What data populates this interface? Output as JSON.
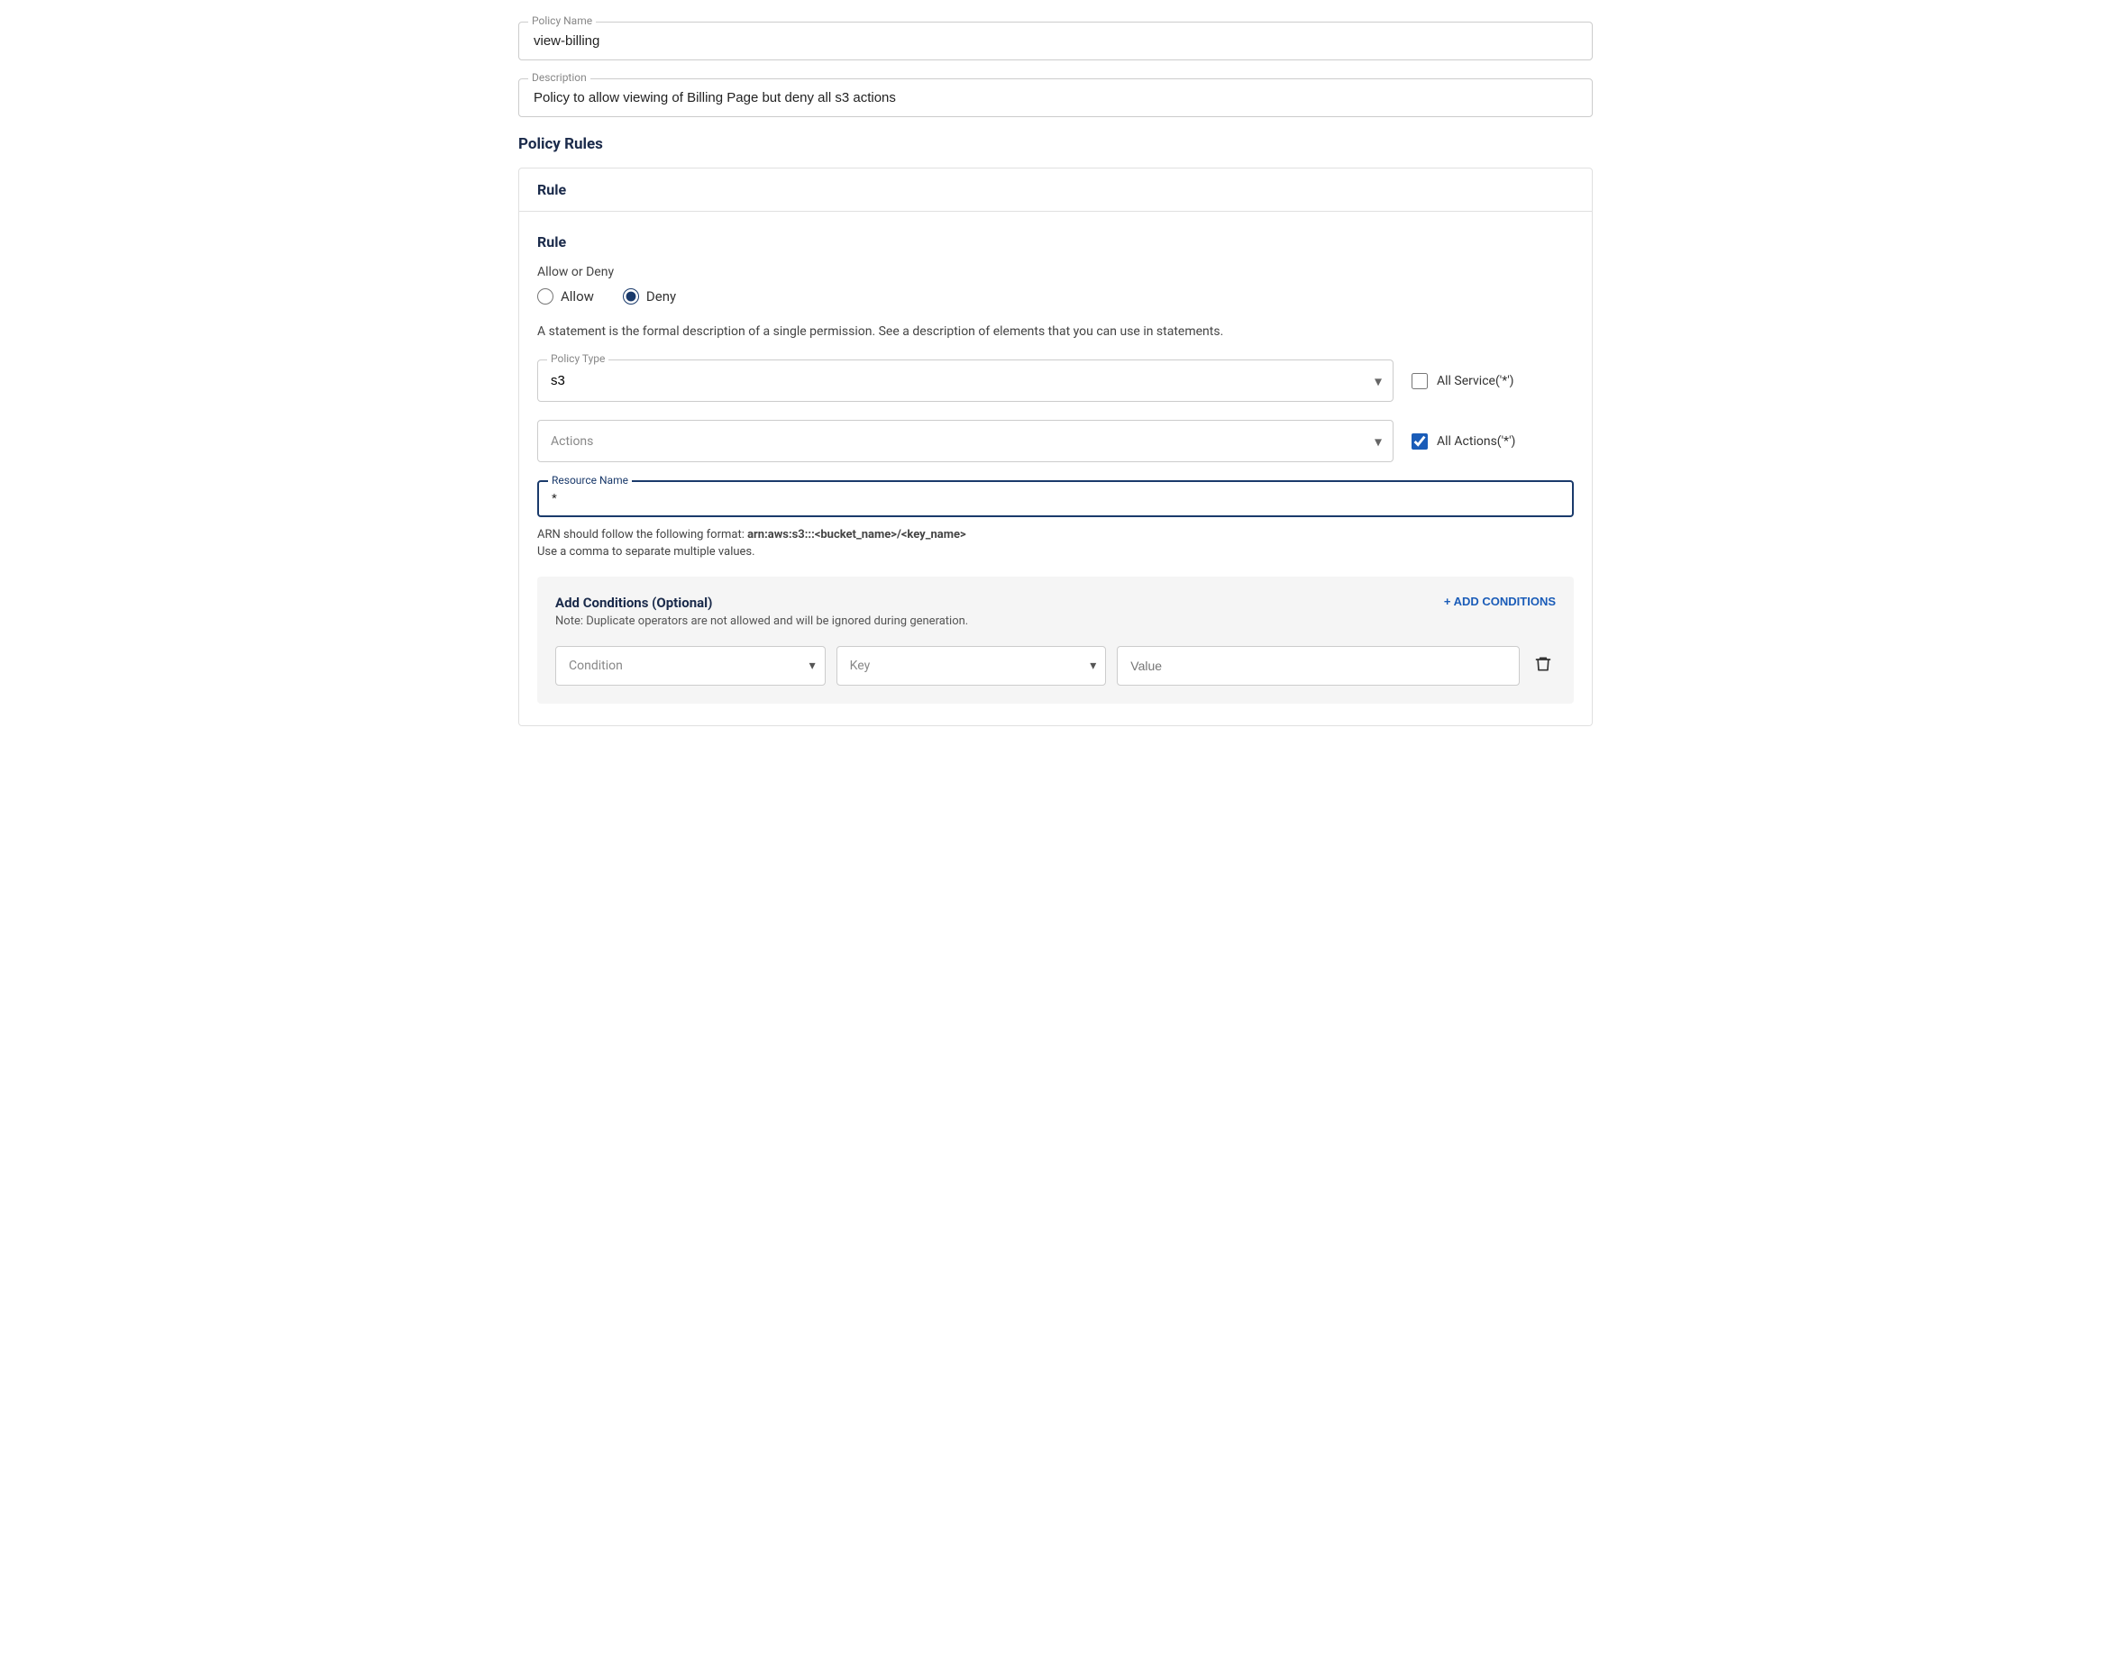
{
  "form": {
    "policy_name_label": "Policy Name",
    "policy_name_value": "view-billing",
    "description_label": "Description",
    "description_value": "Policy to allow viewing of Billing Page but deny all s3 actions"
  },
  "policy_rules": {
    "section_title": "Policy Rules",
    "rule_header": "Rule",
    "rule_inner_title": "Rule",
    "allow_deny_label": "Allow or Deny",
    "allow_label": "Allow",
    "deny_label": "Deny",
    "allow_selected": false,
    "deny_selected": true,
    "statement_desc": "A statement is the formal description of a single permission. See a description of elements that you can use in statements.",
    "policy_type_label": "Policy Type",
    "policy_type_value": "s3",
    "all_service_label": "All Service('*')",
    "all_service_checked": false,
    "actions_placeholder": "Actions",
    "all_actions_label": "All Actions('*')",
    "all_actions_checked": true,
    "resource_name_label": "Resource Name",
    "resource_name_value": "*",
    "arn_hint_prefix": "ARN should follow the following format: ",
    "arn_hint_format": "arn:aws:s3:::<bucket_name>/<key_name>",
    "arn_hint_suffix": "",
    "comma_hint": "Use a comma to separate multiple values.",
    "conditions": {
      "title": "Add Conditions (Optional)",
      "note": "Note: Duplicate operators are not allowed and will be ignored during generation.",
      "add_button_label": "+ ADD CONDITIONS",
      "condition_placeholder": "Condition",
      "key_placeholder": "Key",
      "value_placeholder": "Value"
    }
  }
}
